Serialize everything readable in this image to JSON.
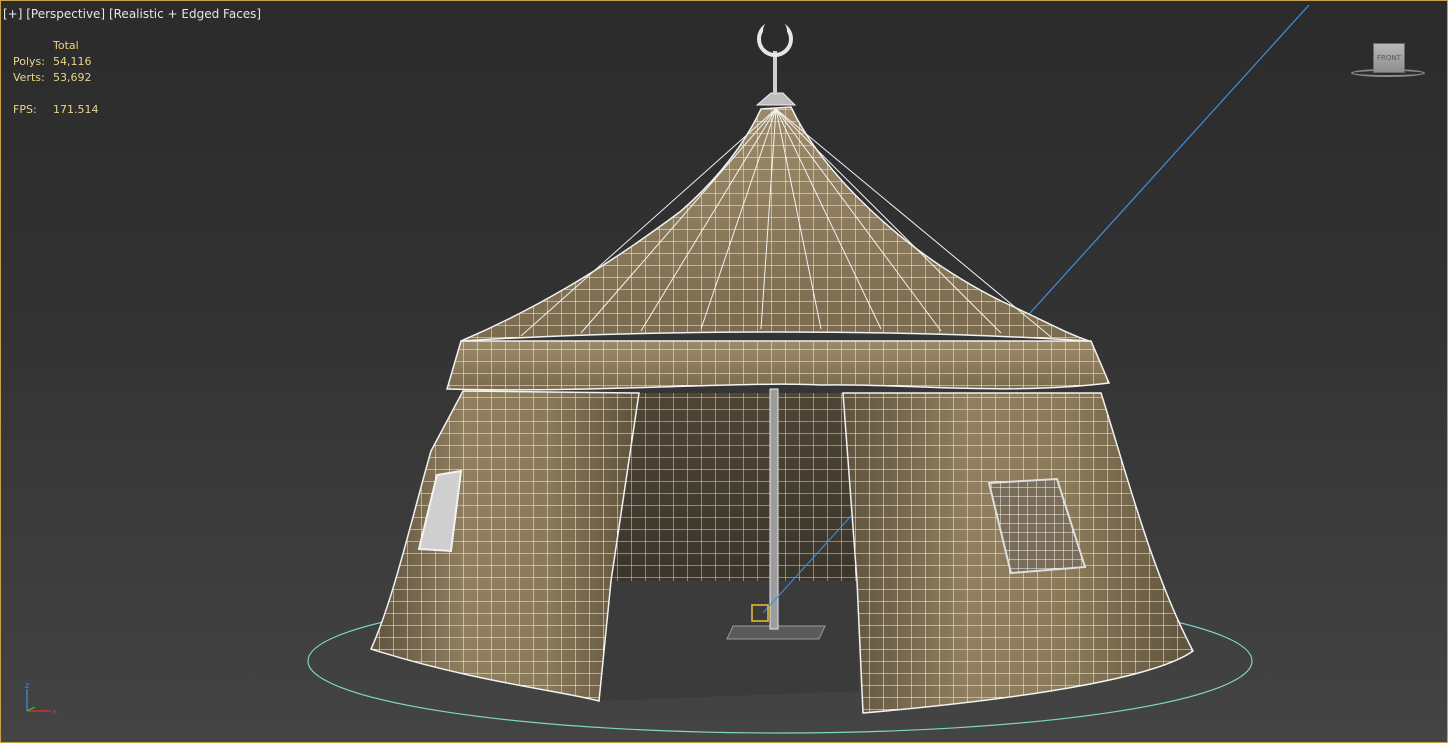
{
  "viewport": {
    "label_plus": "[+]",
    "label_view": "[Perspective]",
    "label_shading": "[Realistic + Edged Faces]"
  },
  "stats": {
    "header": "Total",
    "polys_label": "Polys:",
    "polys_value": "54,116",
    "verts_label": "Verts:",
    "verts_value": "53,692",
    "fps_label": "FPS:",
    "fps_value": "171.514"
  },
  "viewcube": {
    "face_label": "FRONT"
  },
  "colors": {
    "viewport_border": "#c8a24a",
    "stats_text": "#e8d58a",
    "tent_fabric": "#8a7a5c",
    "wire": "#ffffff",
    "ground_circle": "#7fd6c4",
    "guide_line": "#3f8fe0"
  },
  "icons": {
    "viewcube": "viewcube-icon",
    "axis_tripod": "axis-tripod-icon",
    "crescent_finial": "crescent-icon"
  }
}
